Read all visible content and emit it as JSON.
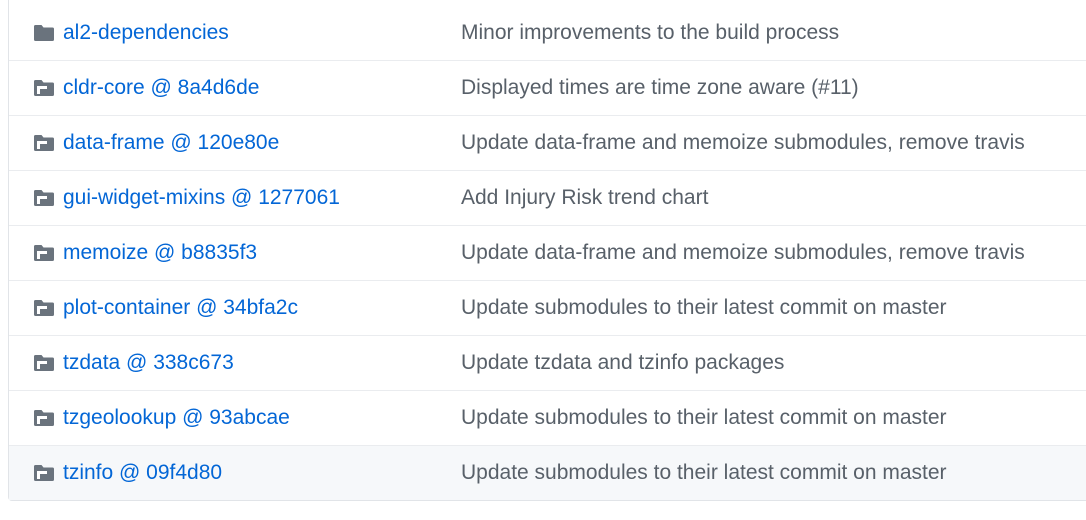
{
  "colors": {
    "link": "#0366d6",
    "message": "#586069",
    "icon": "#6a737d",
    "border": "#e1e4e8",
    "row_hover": "#f6f8fa"
  },
  "files": [
    {
      "name": "al2-dependencies",
      "icon": "folder-icon",
      "message": "Minor improvements to the build process"
    },
    {
      "name": "cldr-core @ 8a4d6de",
      "icon": "submodule-icon",
      "message": "Displayed times are time zone aware (#11)"
    },
    {
      "name": "data-frame @ 120e80e",
      "icon": "submodule-icon",
      "message": "Update data-frame and memoize submodules, remove travis"
    },
    {
      "name": "gui-widget-mixins @ 1277061",
      "icon": "submodule-icon",
      "message": "Add Injury Risk trend chart"
    },
    {
      "name": "memoize @ b8835f3",
      "icon": "submodule-icon",
      "message": "Update data-frame and memoize submodules, remove travis"
    },
    {
      "name": "plot-container @ 34bfa2c",
      "icon": "submodule-icon",
      "message": "Update submodules to their latest commit on master"
    },
    {
      "name": "tzdata @ 338c673",
      "icon": "submodule-icon",
      "message": "Update tzdata and tzinfo packages"
    },
    {
      "name": "tzgeolookup @ 93abcae",
      "icon": "submodule-icon",
      "message": "Update submodules to their latest commit on master"
    },
    {
      "name": "tzinfo @ 09f4d80",
      "icon": "submodule-icon",
      "message": "Update submodules to their latest commit on master"
    }
  ]
}
